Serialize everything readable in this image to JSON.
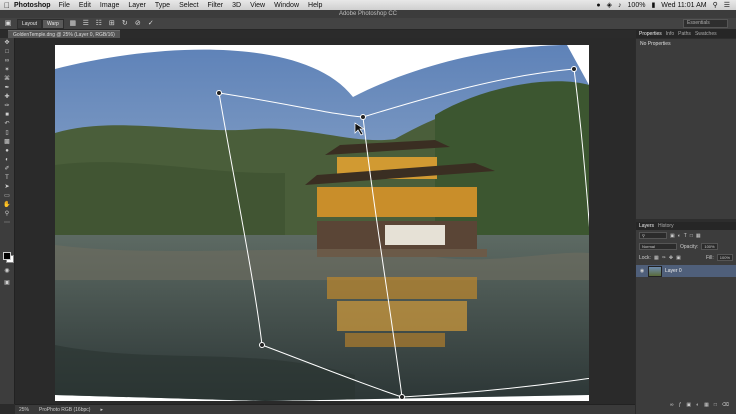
{
  "menubar": {
    "app": "Photoshop",
    "items": [
      "File",
      "Edit",
      "Image",
      "Layer",
      "Type",
      "Select",
      "Filter",
      "3D",
      "View",
      "Window",
      "Help"
    ],
    "battery": "100%",
    "clock": "Wed 11:01 AM"
  },
  "window": {
    "title": "Adobe Photoshop CC"
  },
  "options": {
    "modes": [
      "Layout",
      "Warp"
    ],
    "workspace": "Essentials"
  },
  "document": {
    "tab": "GoldenTemple.dng @ 25% (Layer 0, RGB/16)"
  },
  "status": {
    "zoom": "25%",
    "profile": "ProPhoto RGB (16bpc)"
  },
  "panels": {
    "top_tabs": [
      "Properties",
      "Info",
      "Paths",
      "Swatches"
    ],
    "properties_text": "No Properties",
    "layers_tabs": [
      "Layers",
      "History"
    ],
    "blend_mode": "Normal",
    "opacity_label": "Opacity:",
    "opacity_value": "100%",
    "lock_label": "Lock:",
    "fill_label": "Fill:",
    "fill_value": "100%",
    "layer_name": "Layer 0"
  },
  "colors": {
    "sky": "#7e9cc3",
    "temple": "#c98e2a",
    "water": "#4a5a5e",
    "handle": "#ffffff"
  }
}
